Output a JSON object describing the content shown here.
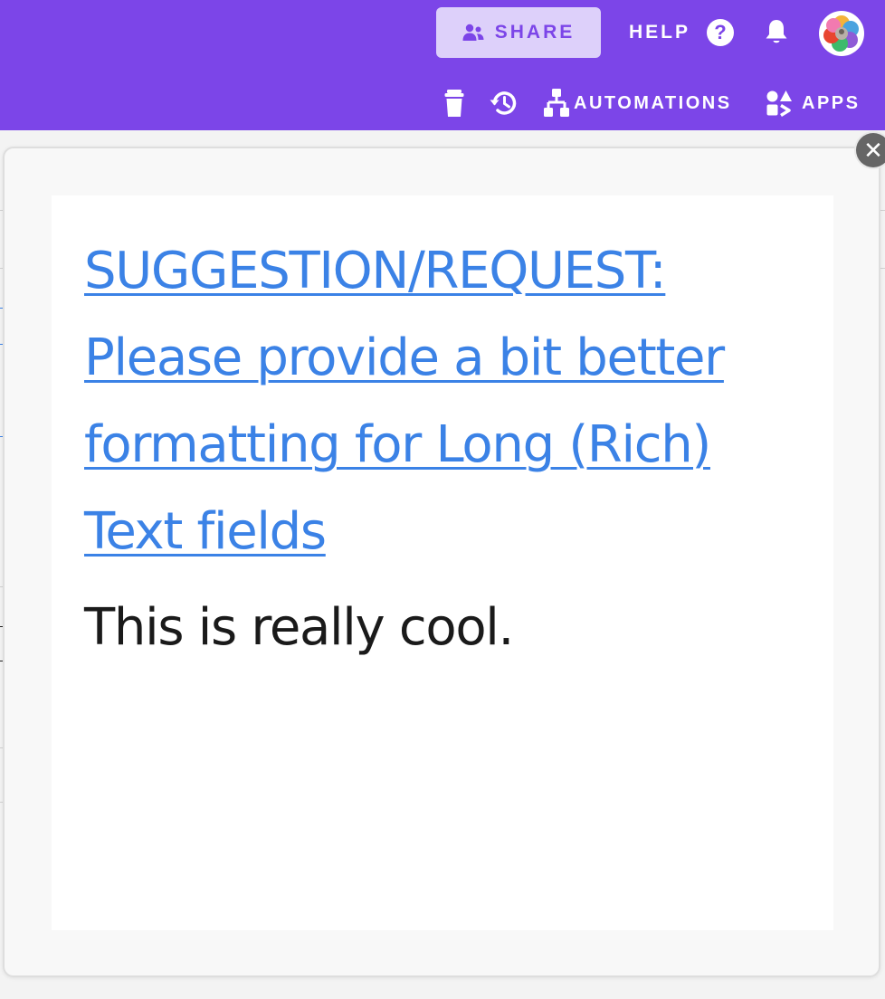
{
  "header": {
    "share_label": "SHARE",
    "help_label": "HELP",
    "help_icon_glyph": "?",
    "notifications_icon": "bell-icon",
    "avatar_icon": "multicolor-avatar",
    "brand_color": "#7c45e8"
  },
  "toolbar": {
    "trash_icon": "trash-icon",
    "history_icon": "history-icon",
    "automations_label": "AUTOMATIONS",
    "apps_label": "APPS"
  },
  "modal": {
    "close_glyph": "✕",
    "link_title": "SUGGESTION/REQUEST: Please provide a bit better formatting for Long (Rich) Text fields",
    "link_color": "#3b82e6",
    "body_text": "This is really cool."
  }
}
